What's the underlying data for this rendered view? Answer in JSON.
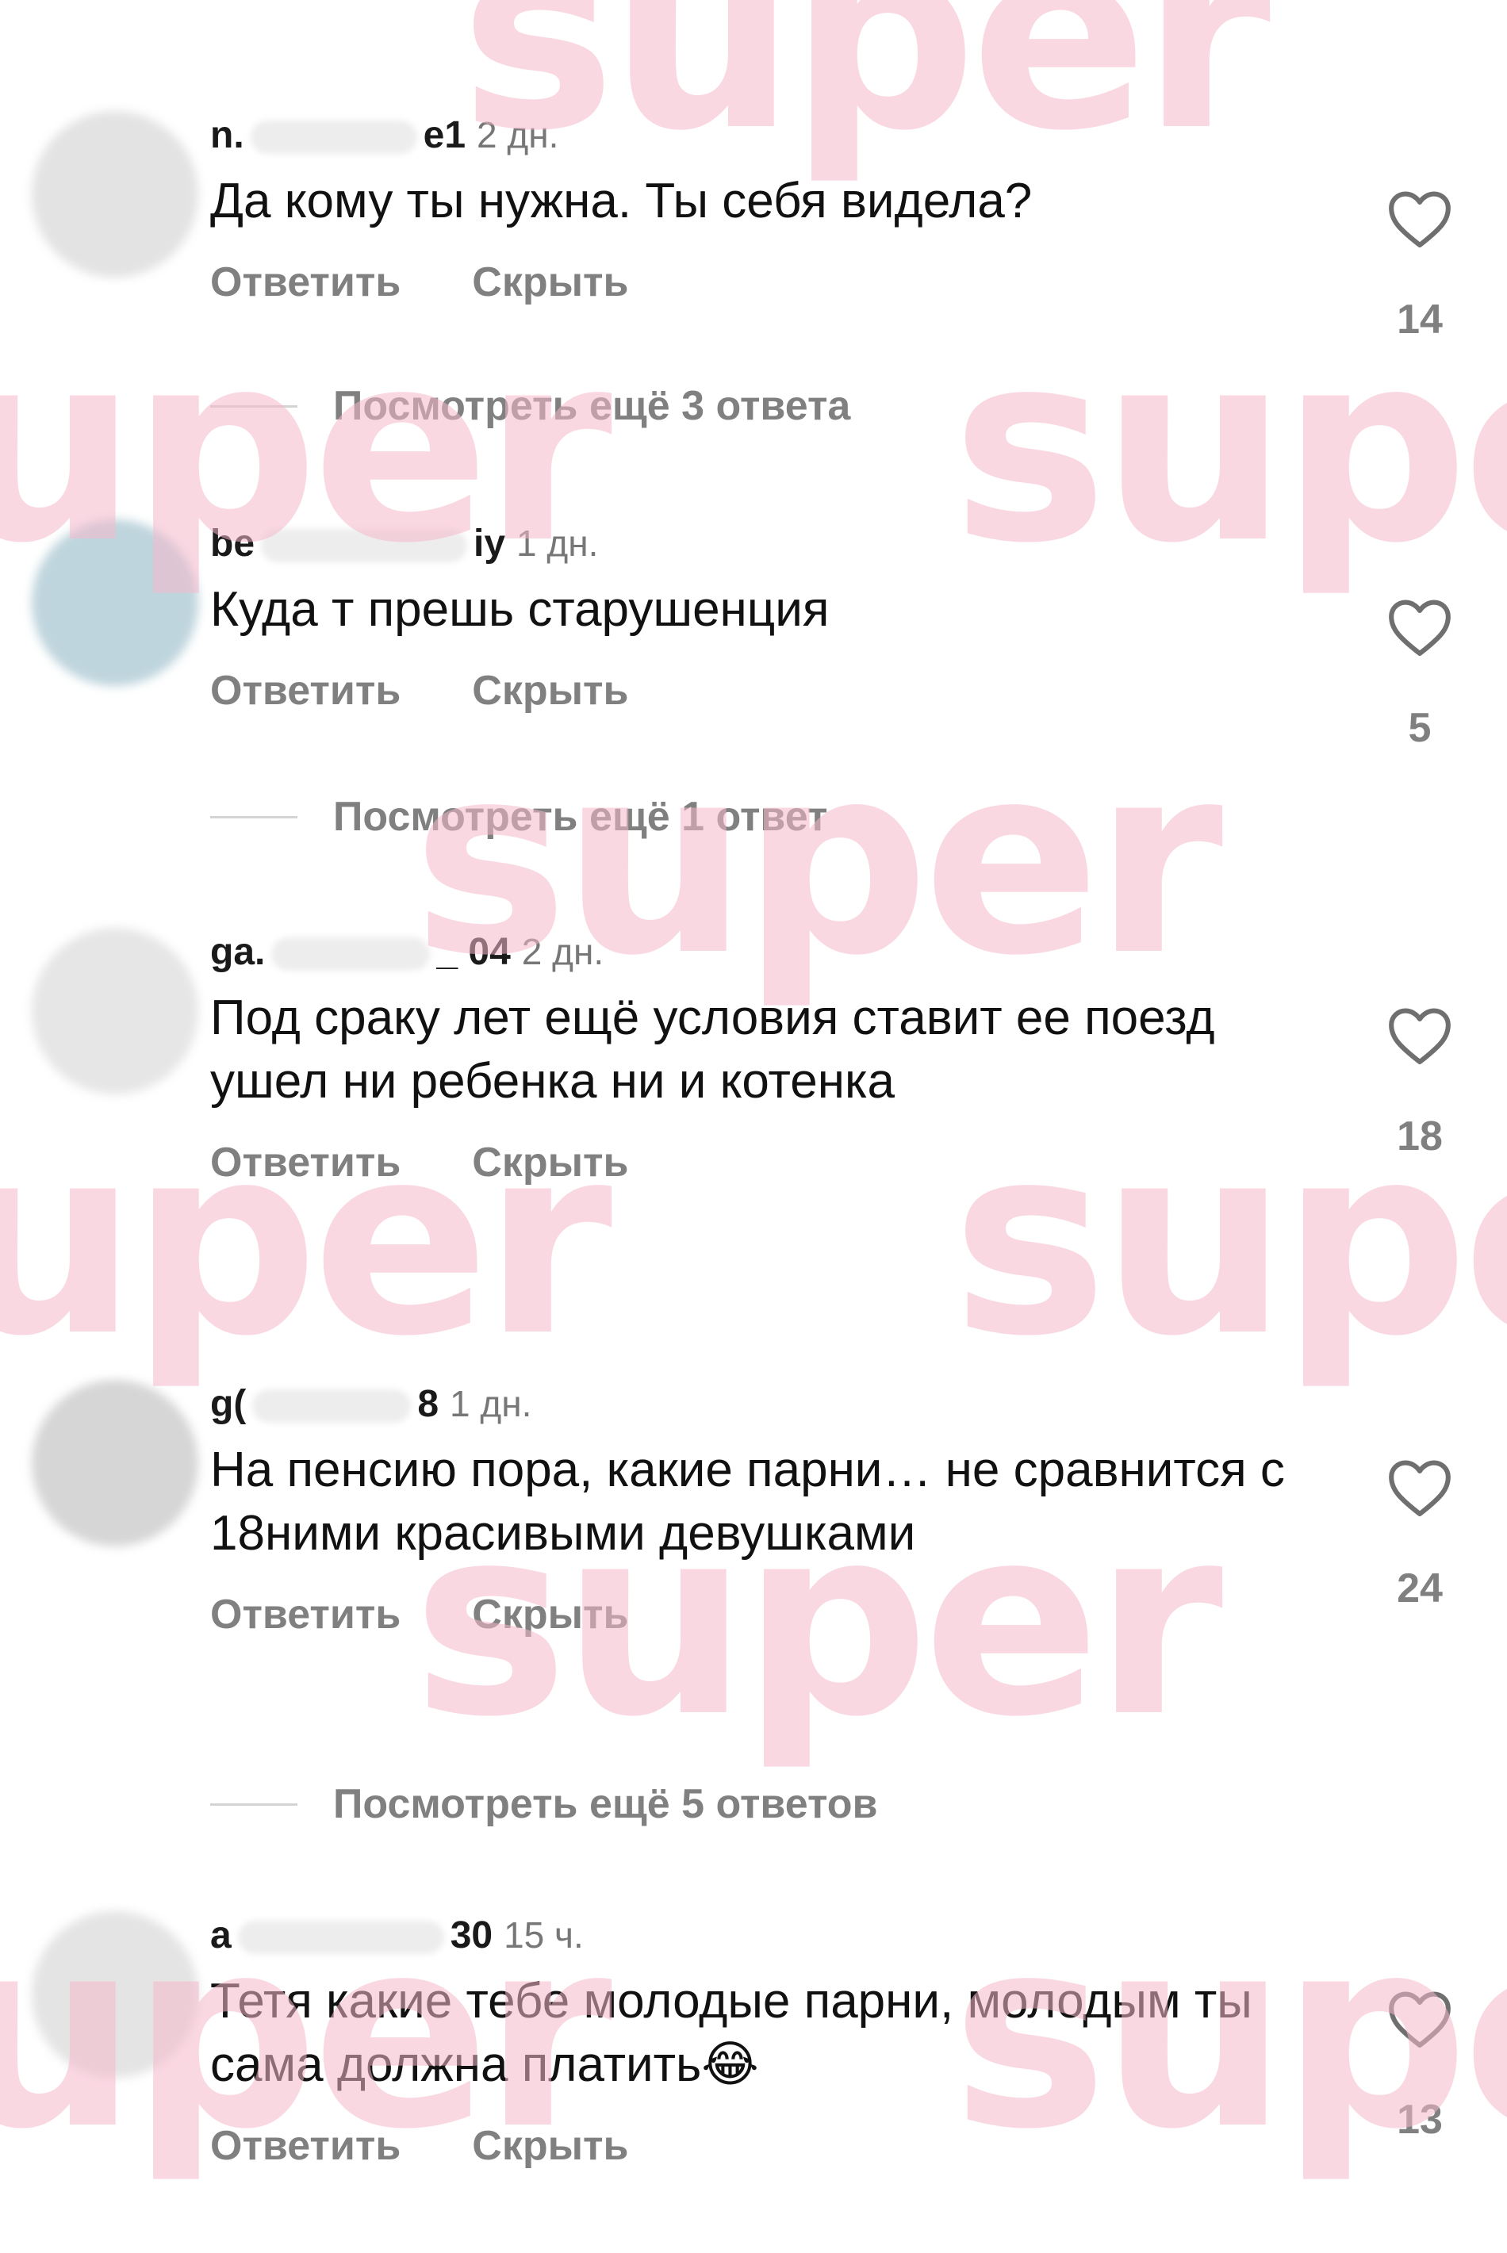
{
  "watermark": "super",
  "comments": [
    {
      "user_start": "n.",
      "user_end": "e1",
      "time": "2 дн.",
      "text": "Да кому ты нужна. Ты себя видела?",
      "reply": "Ответить",
      "hide": "Скрыть",
      "likes": "14",
      "avatar_color": "#e3e3e3"
    },
    {
      "user_start": "be",
      "user_end": "iy",
      "time": "1 дн.",
      "text": "Куда т прешь старушенция",
      "reply": "Ответить",
      "hide": "Скрыть",
      "likes": "5",
      "avatar_color": "#bfd5dd"
    },
    {
      "user_start": "ga.",
      "user_end": "_ 04",
      "time": "2 дн.",
      "text": "Под сраку лет ещё условия ставит ее поезд ушел ни ребенка ни и котенка",
      "reply": "Ответить",
      "hide": "Скрыть",
      "likes": "18",
      "avatar_color": "#e6e6e6"
    },
    {
      "user_start": "g(",
      "user_end": "8",
      "time": "1 дн.",
      "text": "На пенсию пора, какие парни… не сравнится с 18ними красивыми девушками",
      "reply": "Ответить",
      "hide": "Скрыть",
      "likes": "24",
      "avatar_color": "#d6d6d6"
    },
    {
      "user_start": "a",
      "user_end": "30",
      "time": "15 ч.",
      "text": "Тетя какие тебе молодые парни, молодым ты сама должна платить😂",
      "reply": "Ответить",
      "hide": "Скрыть",
      "likes": "13",
      "avatar_color": "#e4e4e4"
    }
  ],
  "more_replies": [
    "Посмотреть ещё 3 ответа",
    "Посмотреть ещё 1 ответ",
    "Посмотреть ещё 5 ответов"
  ]
}
